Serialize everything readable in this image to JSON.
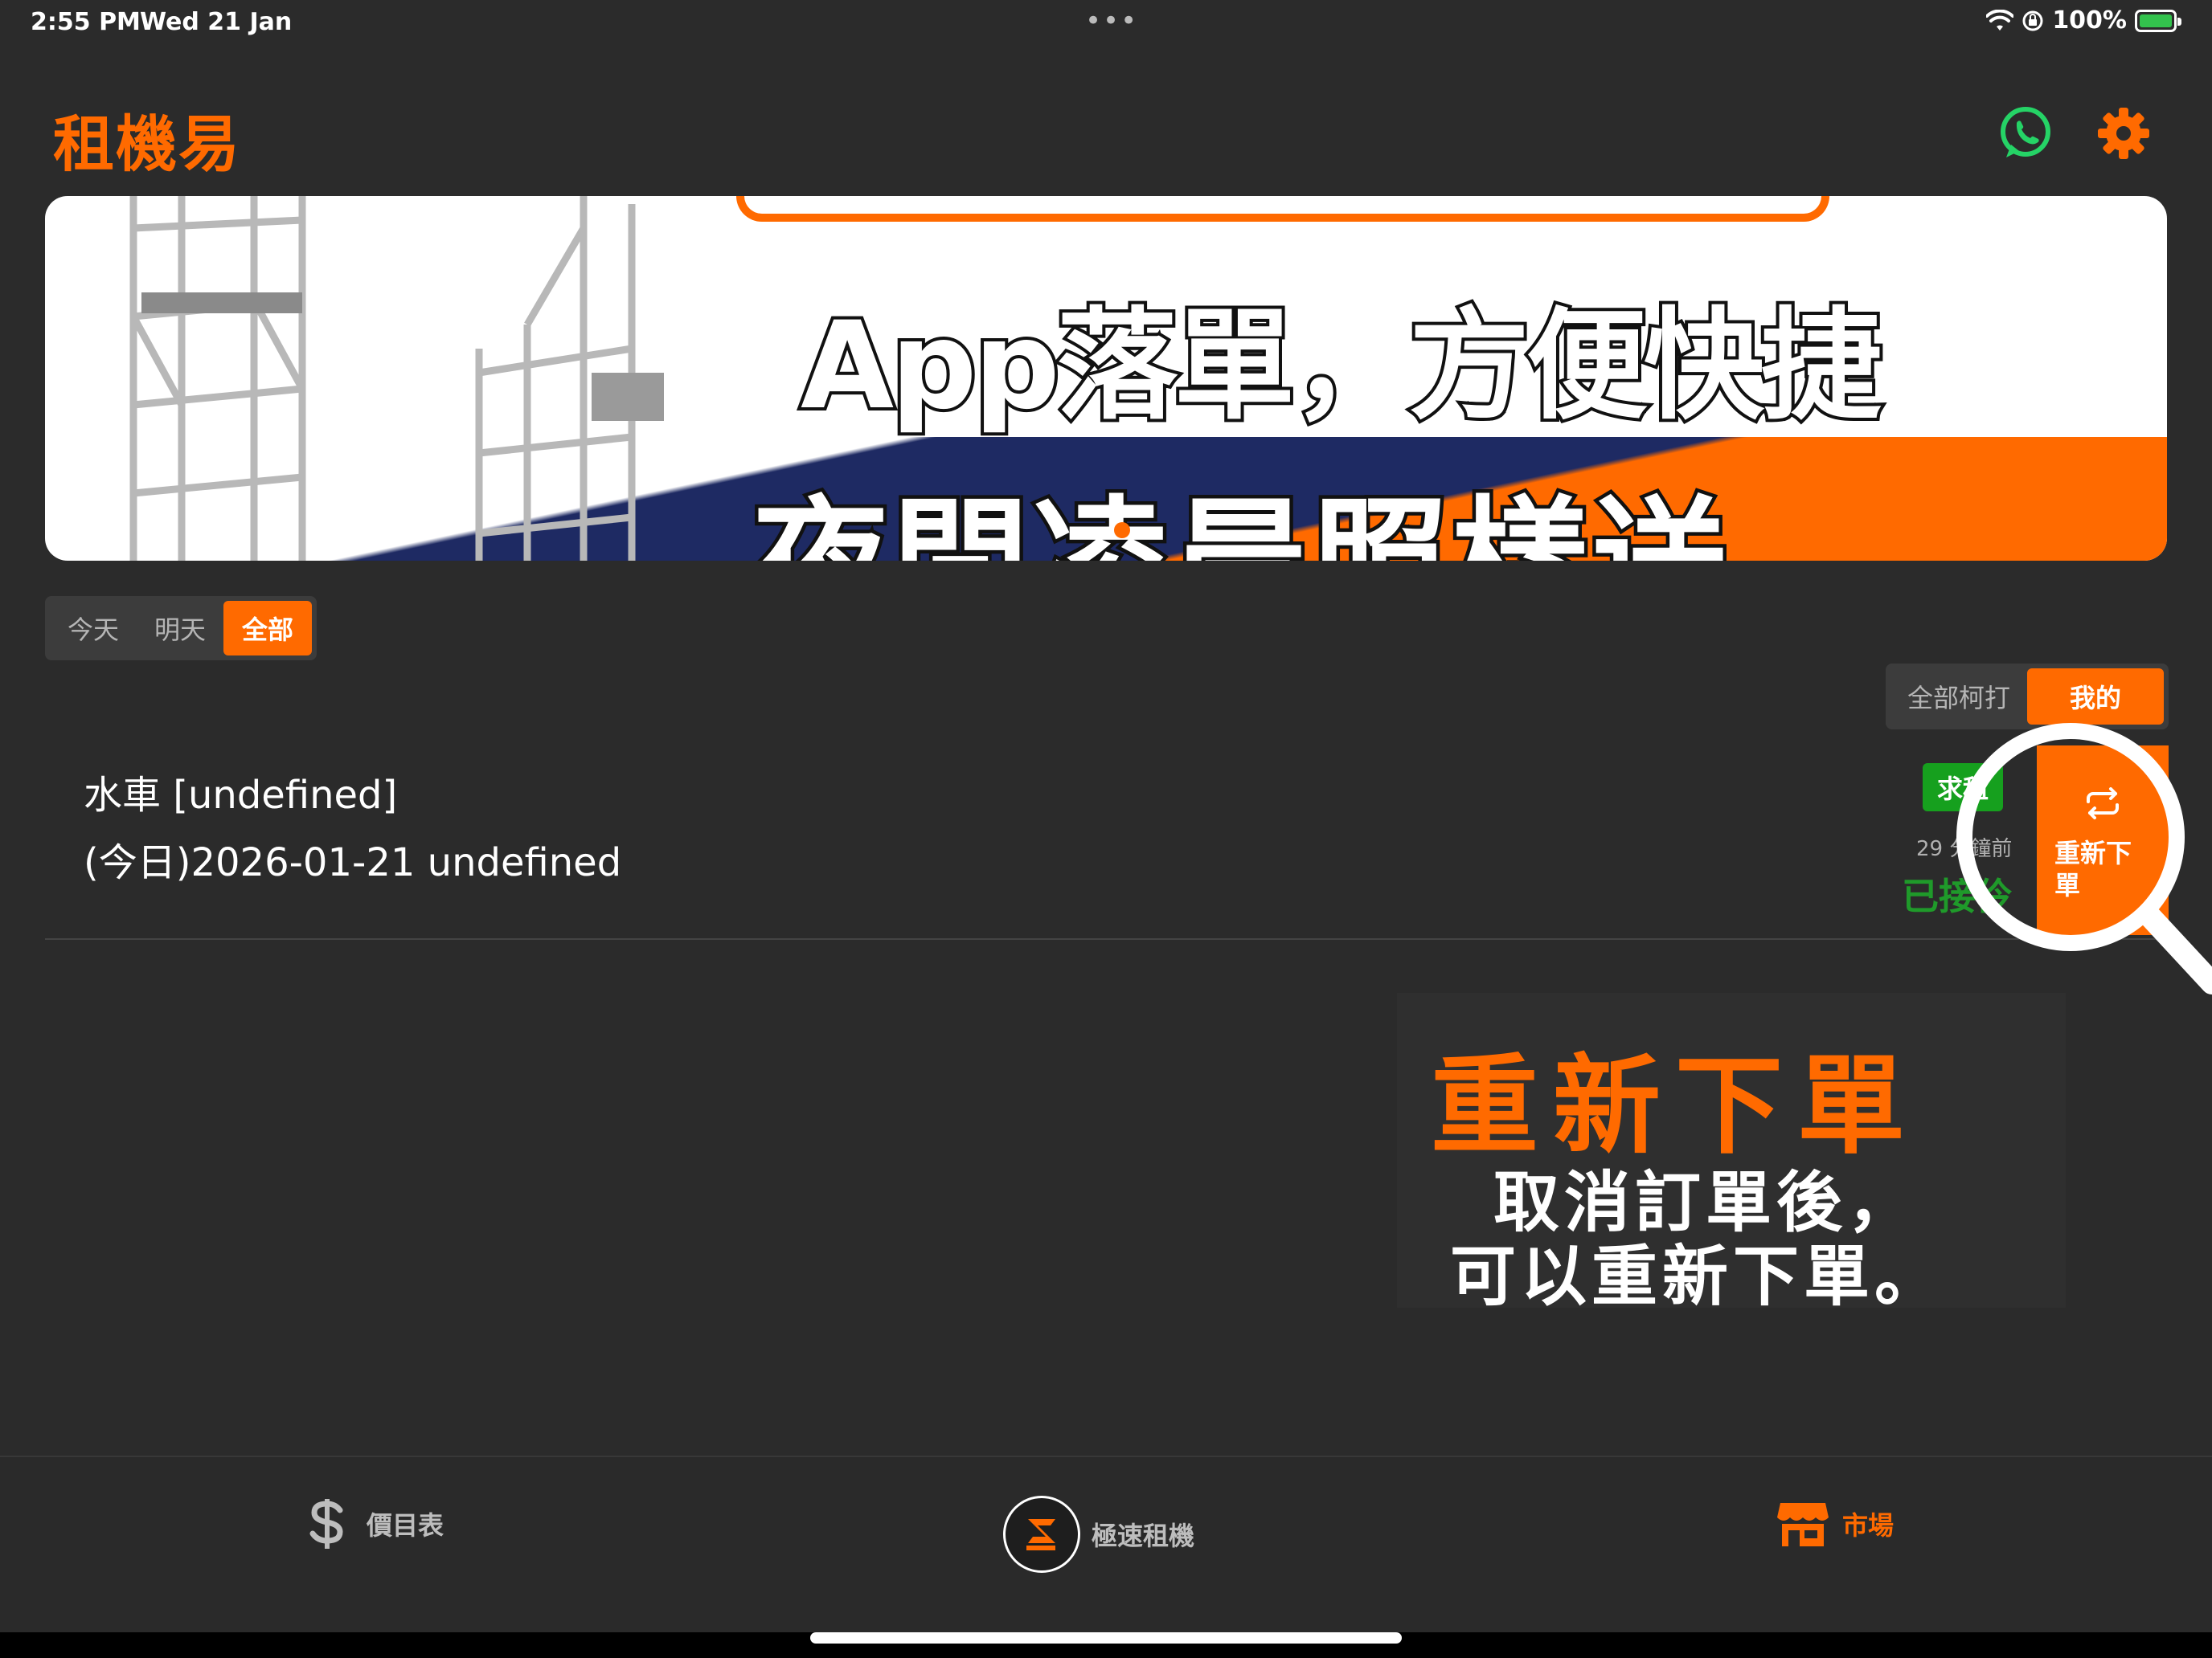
{
  "status_bar": {
    "time": "2:55 PM",
    "date": "Wed 21 Jan",
    "battery": "100%",
    "multitask_dots": "•••",
    "battery_level": 1.0
  },
  "header": {
    "title": "租機易",
    "icons": [
      "whatsapp-icon",
      "gear-icon"
    ]
  },
  "banner": {
    "line1": "App落單，方便快捷",
    "line2": "夜間凌晨照樣送",
    "accent_color": "#ff6a00"
  },
  "date_filter": {
    "options": [
      "今天",
      "明天",
      "全部"
    ],
    "selected": "全部"
  },
  "orders_filter": {
    "options": [
      "全部柯打",
      "我的"
    ],
    "selected": "我的"
  },
  "order": {
    "title": "水車 [undefined]",
    "subtitle": "(今日)2026-01-21  undefined",
    "badge": "求租",
    "time_ago": "29 分鐘前",
    "status": "已接伶",
    "action_label": "重新下單",
    "action_icon": "repeat-icon"
  },
  "tooltip": {
    "title": "重新下單",
    "line1": "取消訂單後，",
    "line2": "可以重新下單。"
  },
  "tab_bar": {
    "tabs": [
      {
        "label": "價目表",
        "icon": "dollar-icon"
      },
      {
        "label": "極速租機",
        "icon": "fast-rent-logo-icon"
      },
      {
        "label": "市場",
        "icon": "store-icon"
      }
    ],
    "active": "市場"
  },
  "colors": {
    "accent": "#ff6a00",
    "background": "#2b2b2b",
    "success": "#16a01e",
    "whatsapp": "#25d366"
  }
}
